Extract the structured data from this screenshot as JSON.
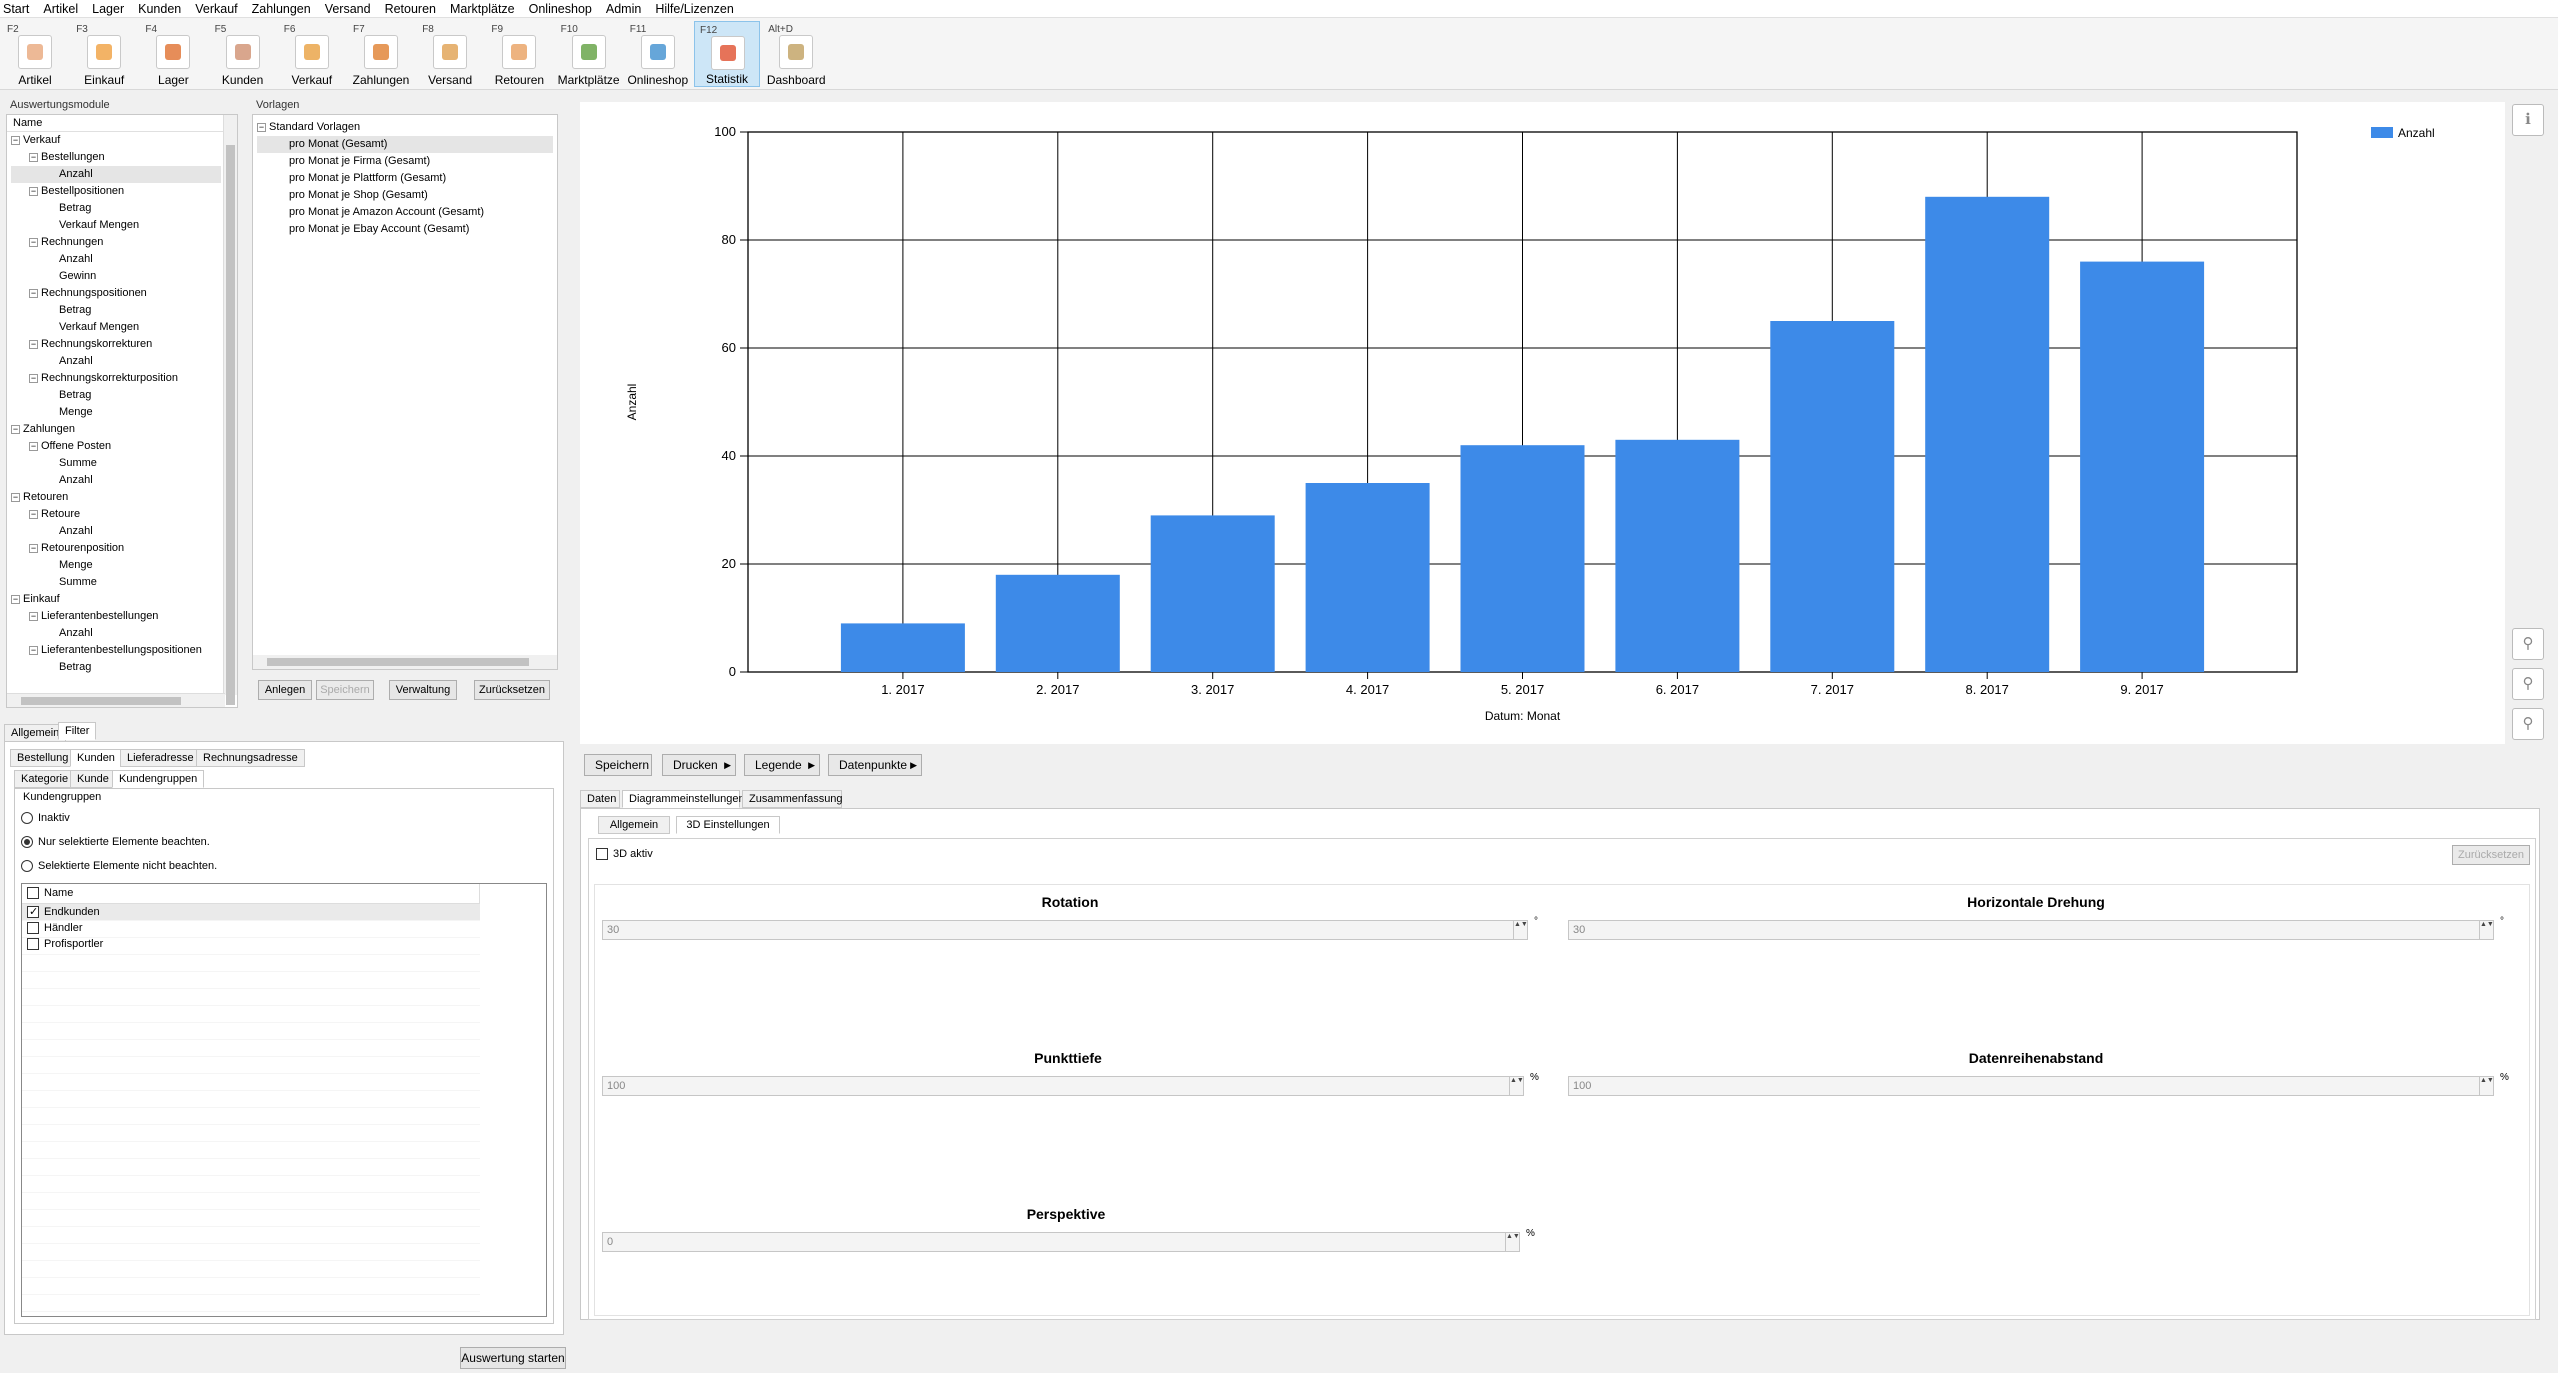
{
  "menu": [
    "Start",
    "Artikel",
    "Lager",
    "Kunden",
    "Verkauf",
    "Zahlungen",
    "Versand",
    "Retouren",
    "Marktplätze",
    "Onlineshop",
    "Admin",
    "Hilfe/Lizenzen"
  ],
  "toolbar": [
    {
      "key": "F2",
      "label": "Artikel",
      "color": "#e8a87c"
    },
    {
      "key": "F3",
      "label": "Einkauf",
      "color": "#f0a040"
    },
    {
      "key": "F4",
      "label": "Lager",
      "color": "#e07030"
    },
    {
      "key": "F5",
      "label": "Kunden",
      "color": "#d09070"
    },
    {
      "key": "F6",
      "label": "Verkauf",
      "color": "#e8a040"
    },
    {
      "key": "F7",
      "label": "Zahlungen",
      "color": "#e08030"
    },
    {
      "key": "F8",
      "label": "Versand",
      "color": "#e0a050"
    },
    {
      "key": "F9",
      "label": "Retouren",
      "color": "#e8a060"
    },
    {
      "key": "F10",
      "label": "Marktplätze",
      "color": "#60a040"
    },
    {
      "key": "F11",
      "label": "Onlineshop",
      "color": "#4090d0"
    },
    {
      "key": "F12",
      "label": "Statistik",
      "color": "#e05030"
    },
    {
      "key": "Alt+D",
      "label": "Dashboard",
      "color": "#c0a060"
    }
  ],
  "modules": {
    "title": "Auswertungsmodule",
    "header": "Name",
    "items": [
      {
        "t": "Verkauf",
        "l": 0,
        "ex": true
      },
      {
        "t": "Bestellungen",
        "l": 1,
        "ex": true
      },
      {
        "t": "Anzahl",
        "l": 2,
        "sel": true
      },
      {
        "t": "Bestellpositionen",
        "l": 1,
        "ex": true
      },
      {
        "t": "Betrag",
        "l": 2
      },
      {
        "t": "Verkauf Mengen",
        "l": 2
      },
      {
        "t": "Rechnungen",
        "l": 1,
        "ex": true
      },
      {
        "t": "Anzahl",
        "l": 2
      },
      {
        "t": "Gewinn",
        "l": 2
      },
      {
        "t": "Rechnungspositionen",
        "l": 1,
        "ex": true
      },
      {
        "t": "Betrag",
        "l": 2
      },
      {
        "t": "Verkauf Mengen",
        "l": 2
      },
      {
        "t": "Rechnungskorrekturen",
        "l": 1,
        "ex": true
      },
      {
        "t": "Anzahl",
        "l": 2
      },
      {
        "t": "Rechnungskorrekturposition",
        "l": 1,
        "ex": true
      },
      {
        "t": "Betrag",
        "l": 2
      },
      {
        "t": "Menge",
        "l": 2
      },
      {
        "t": "Zahlungen",
        "l": 0,
        "ex": true
      },
      {
        "t": "Offene Posten",
        "l": 1,
        "ex": true
      },
      {
        "t": "Summe",
        "l": 2
      },
      {
        "t": "Anzahl",
        "l": 2
      },
      {
        "t": "Retouren",
        "l": 0,
        "ex": true
      },
      {
        "t": "Retoure",
        "l": 1,
        "ex": true
      },
      {
        "t": "Anzahl",
        "l": 2
      },
      {
        "t": "Retourenposition",
        "l": 1,
        "ex": true
      },
      {
        "t": "Menge",
        "l": 2
      },
      {
        "t": "Summe",
        "l": 2
      },
      {
        "t": "Einkauf",
        "l": 0,
        "ex": true
      },
      {
        "t": "Lieferantenbestellungen",
        "l": 1,
        "ex": true
      },
      {
        "t": "Anzahl",
        "l": 2
      },
      {
        "t": "Lieferantenbestellungspositionen",
        "l": 1,
        "ex": true
      },
      {
        "t": "Betrag",
        "l": 2
      }
    ]
  },
  "templates": {
    "title": "Vorlagen",
    "root": "Standard Vorlagen",
    "items": [
      "pro Monat (Gesamt)",
      "pro Monat je Firma (Gesamt)",
      "pro Monat je Plattform (Gesamt)",
      "pro Monat je Shop (Gesamt)",
      "pro Monat je Amazon Account (Gesamt)",
      "pro Monat je Ebay Account (Gesamt)"
    ],
    "buttons": [
      "Anlegen",
      "Speichern",
      "Verwaltung",
      "Zurücksetzen"
    ]
  },
  "filter": {
    "tabs_top": [
      "Allgemein",
      "Filter"
    ],
    "tabs_mid": [
      "Bestellung",
      "Kunden",
      "Lieferadresse",
      "Rechnungsadresse"
    ],
    "tabs_low": [
      "Kategorie",
      "Kunde",
      "Kundengruppen"
    ],
    "group_title": "Kundengruppen",
    "radios": [
      "Inaktiv",
      "Nur selektierte Elemente beachten.",
      "Selektierte Elemente nicht beachten."
    ],
    "list_header": "Name",
    "list": [
      {
        "t": "Endkunden",
        "c": true
      },
      {
        "t": "Händler",
        "c": false
      },
      {
        "t": "Profisportler",
        "c": false
      }
    ],
    "start_button": "Auswertung starten"
  },
  "chart_data": {
    "type": "bar",
    "categories": [
      "1. 2017",
      "2. 2017",
      "3. 2017",
      "4. 2017",
      "5. 2017",
      "6. 2017",
      "7. 2017",
      "8. 2017",
      "9. 2017"
    ],
    "series": [
      {
        "name": "Anzahl",
        "values": [
          9,
          18,
          29,
          35,
          42,
          43,
          65,
          88,
          76
        ]
      }
    ],
    "title": "",
    "xlabel": "Datum: Monat",
    "ylabel": "Anzahl",
    "ylim": [
      0,
      100
    ],
    "yticks": [
      0,
      20,
      40,
      60,
      80,
      100
    ],
    "grid": true,
    "legend": "top-right",
    "color": "#3d8ae8"
  },
  "chart_buttons": [
    "Speichern",
    "Drucken",
    "Legende",
    "Datenpunkte"
  ],
  "settings": {
    "tabs": [
      "Daten",
      "Diagrammeinstellungen",
      "Zusammenfassung"
    ],
    "subtabs": [
      "Allgemein",
      "3D Einstellungen"
    ],
    "check3d": "3D aktiv",
    "reset": "Zurücksetzen",
    "fields": [
      {
        "title": "Rotation",
        "value": "30",
        "unit": "°"
      },
      {
        "title": "Horizontale Drehung",
        "value": "30",
        "unit": "°"
      },
      {
        "title": "Punkttiefe",
        "value": "100",
        "unit": "%"
      },
      {
        "title": "Datenreihenabstand",
        "value": "100",
        "unit": "%"
      },
      {
        "title": "Perspektive",
        "value": "0",
        "unit": "%"
      }
    ]
  }
}
